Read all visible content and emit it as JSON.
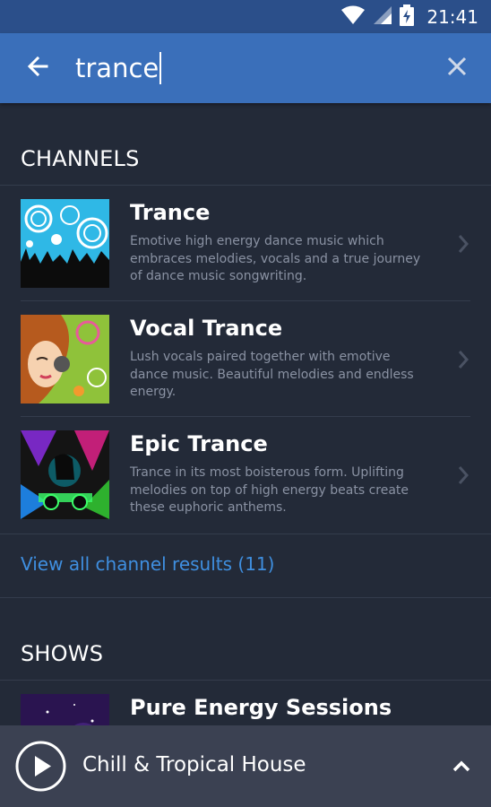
{
  "status_bar": {
    "time": "21:41",
    "icons": [
      "wifi-icon",
      "cellular-signal-icon",
      "battery-charging-icon"
    ]
  },
  "search": {
    "query": "trance",
    "back_icon": "back-arrow-icon",
    "clear_icon": "close-icon"
  },
  "channels": {
    "header": "CHANNELS",
    "items": [
      {
        "title": "Trance",
        "description": "Emotive high energy dance music which embraces melodies, vocals and a true journey of dance music songwriting.",
        "thumbnail": "trance-artwork"
      },
      {
        "title": "Vocal Trance",
        "description": "Lush vocals paired together with emotive dance music. Beautiful melodies and endless energy.",
        "thumbnail": "vocal-trance-artwork"
      },
      {
        "title": "Epic Trance",
        "description": "Trance in its most boisterous form. Uplifting melodies on top of high energy beats create these euphoric anthems.",
        "thumbnail": "epic-trance-artwork"
      }
    ],
    "view_all": "View all channel results (11)"
  },
  "shows": {
    "header": "SHOWS",
    "items": [
      {
        "title": "Pure Energy Sessions",
        "thumbnail": "pure-energy-artwork"
      }
    ]
  },
  "now_playing": {
    "title": "Chill & Tropical House",
    "play_icon": "play-icon",
    "expand_icon": "chevron-up-icon"
  },
  "colors": {
    "status_bar": "#2b4f8a",
    "search_bar": "#3a6fba",
    "background": "#232a38",
    "divider": "#343c4c",
    "description_text": "#8a92a3",
    "link": "#3f8fe0",
    "now_playing_bar": "#3b4152"
  }
}
